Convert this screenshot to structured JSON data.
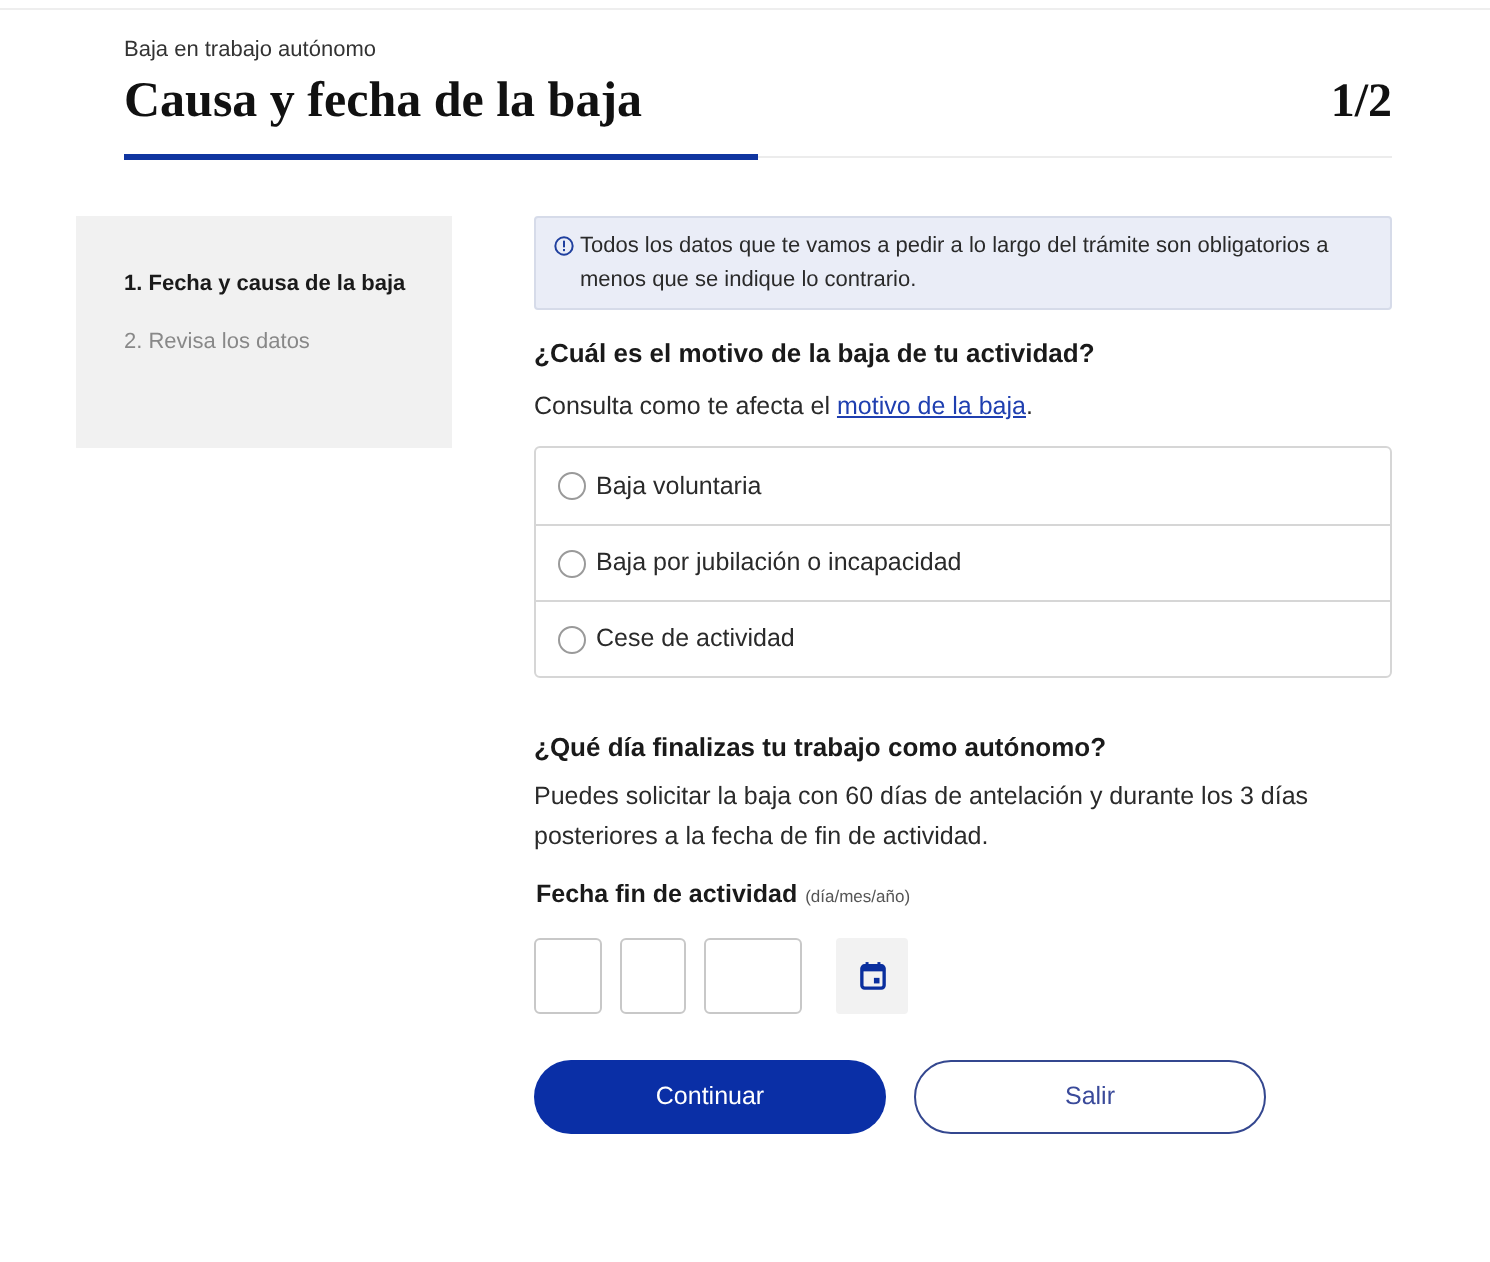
{
  "header": {
    "breadcrumb": "Baja en trabajo autónomo",
    "title": "Causa y fecha de la baja",
    "step": "1/2",
    "progress": {
      "level": 0.5
    }
  },
  "steps": [
    {
      "label": "1. Fecha y causa de la baja",
      "selected": true
    },
    {
      "label": "2. Revisa los datos",
      "selected": false
    }
  ],
  "info": {
    "text": "Todos los datos que te vamos a pedir a lo largo del trámite son obligatorios a menos que se indique lo contrario."
  },
  "reason": {
    "question": "¿Cuál es el motivo de la baja de tu actividad?",
    "hint": {
      "text": "Consulta como te afecta el",
      "link": "motivo de la baja",
      "end": "."
    },
    "options": [
      {
        "label": "Baja voluntaria",
        "selected": false
      },
      {
        "label": "Baja por jubilación o incapacidad",
        "selected": false
      },
      {
        "label": "Cese de actividad",
        "selected": false
      }
    ]
  },
  "end_date": {
    "question": "¿Qué día finalizas tu trabajo como autónomo?",
    "description": "Puedes solicitar la baja con 60 días de antelación y durante los 3 días posteriores a la fecha de fin de actividad.",
    "label": "Fecha fin de actividad",
    "format": "(día/mes/año)",
    "fields": [
      {
        "kind": "day"
      },
      {
        "kind": "month"
      },
      {
        "kind": "year"
      }
    ]
  },
  "buttons": [
    {
      "label": "Continuar",
      "kind": "primary"
    },
    {
      "label": "Salir",
      "kind": "secondary"
    }
  ]
}
